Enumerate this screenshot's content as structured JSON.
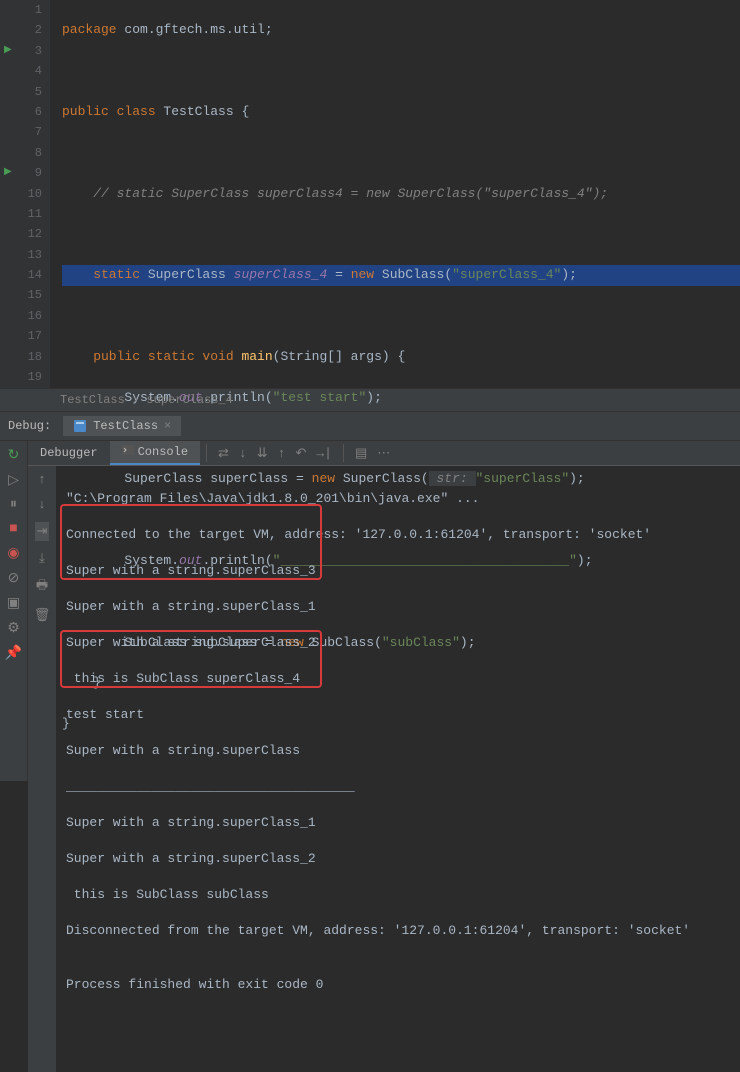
{
  "code": {
    "lines": [
      {
        "n": 1,
        "run": false
      },
      {
        "n": 2,
        "run": false
      },
      {
        "n": 3,
        "run": true
      },
      {
        "n": 4,
        "run": false
      },
      {
        "n": 5,
        "run": false
      },
      {
        "n": 6,
        "run": false
      },
      {
        "n": 7,
        "run": false
      },
      {
        "n": 8,
        "run": false
      },
      {
        "n": 9,
        "run": true
      },
      {
        "n": 10,
        "run": false
      },
      {
        "n": 11,
        "run": false
      },
      {
        "n": 12,
        "run": false
      },
      {
        "n": 13,
        "run": false
      },
      {
        "n": 14,
        "run": false
      },
      {
        "n": 15,
        "run": false
      },
      {
        "n": 16,
        "run": false
      },
      {
        "n": 17,
        "run": false
      },
      {
        "n": 18,
        "run": false
      },
      {
        "n": 19,
        "run": false
      }
    ],
    "l1_kw1": "package ",
    "l1_pkg": "com.gftech.ms.util;",
    "l3_kw1": "public class ",
    "l3_cls": "TestClass",
    "l3_b": " {",
    "l5_com": "    // static SuperClass superClass4 = new SuperClass(\"superClass_4\");",
    "l7_kw1": "    static ",
    "l7_cls": "SuperClass ",
    "l7_fld": "superClass_4",
    "l7_eq": " = ",
    "l7_kw2": "new ",
    "l7_cls2": "SubClass(",
    "l7_str": "\"superClass_4\"",
    "l7_end": ");",
    "l9_kw1": "    public static void ",
    "l9_mtd": "main",
    "l9_p1": "(String[] args) {",
    "l10_ind": "        System.",
    "l10_out": "out",
    "l10_p": ".println(",
    "l10_str": "\"test start\"",
    "l10_e": ");",
    "l12_ind": "        SuperClass superClass = ",
    "l12_kw": "new ",
    "l12_cls": "SuperClass(",
    "l12_hint": " str: ",
    "l12_str": "\"superClass\"",
    "l12_e": ");",
    "l14_ind": "        System.",
    "l14_out": "out",
    "l14_p": ".println(",
    "l14_str": "\"_____________________________________\"",
    "l14_e": ");",
    "l16_ind": "        SubClass subClass = ",
    "l16_kw": "new ",
    "l16_cls": "SubClass(",
    "l16_str": "\"subClass\"",
    "l16_e": ");",
    "l17": "    }",
    "l18": "}"
  },
  "breadcrumb": {
    "part1": "TestClass",
    "sep": " › ",
    "part2": "superClass_4"
  },
  "debug": {
    "label": "Debug:",
    "tab_name": "TestClass",
    "tabs": {
      "debugger": "Debugger",
      "console": "Console"
    }
  },
  "console": {
    "line1": "\"C:\\Program Files\\Java\\jdk1.8.0_201\\bin\\java.exe\" ...",
    "line2": "Connected to the target VM, address: '127.0.0.1:61204', transport: 'socket'",
    "line3": "Super with a string.superClass_3",
    "line4": "Super with a string.superClass_1",
    "line5": "Super with a string.superClass_2",
    "line6": " this is SubClass superClass_4",
    "line7": "test start",
    "line8": "Super with a string.superClass",
    "line9": "_____________________________________",
    "line10": "Super with a string.superClass_1",
    "line11": "Super with a string.superClass_2",
    "line12": " this is SubClass subClass",
    "line13": "Disconnected from the target VM, address: '127.0.0.1:61204', transport: 'socket'",
    "line14": "",
    "line15": "Process finished with exit code 0"
  }
}
